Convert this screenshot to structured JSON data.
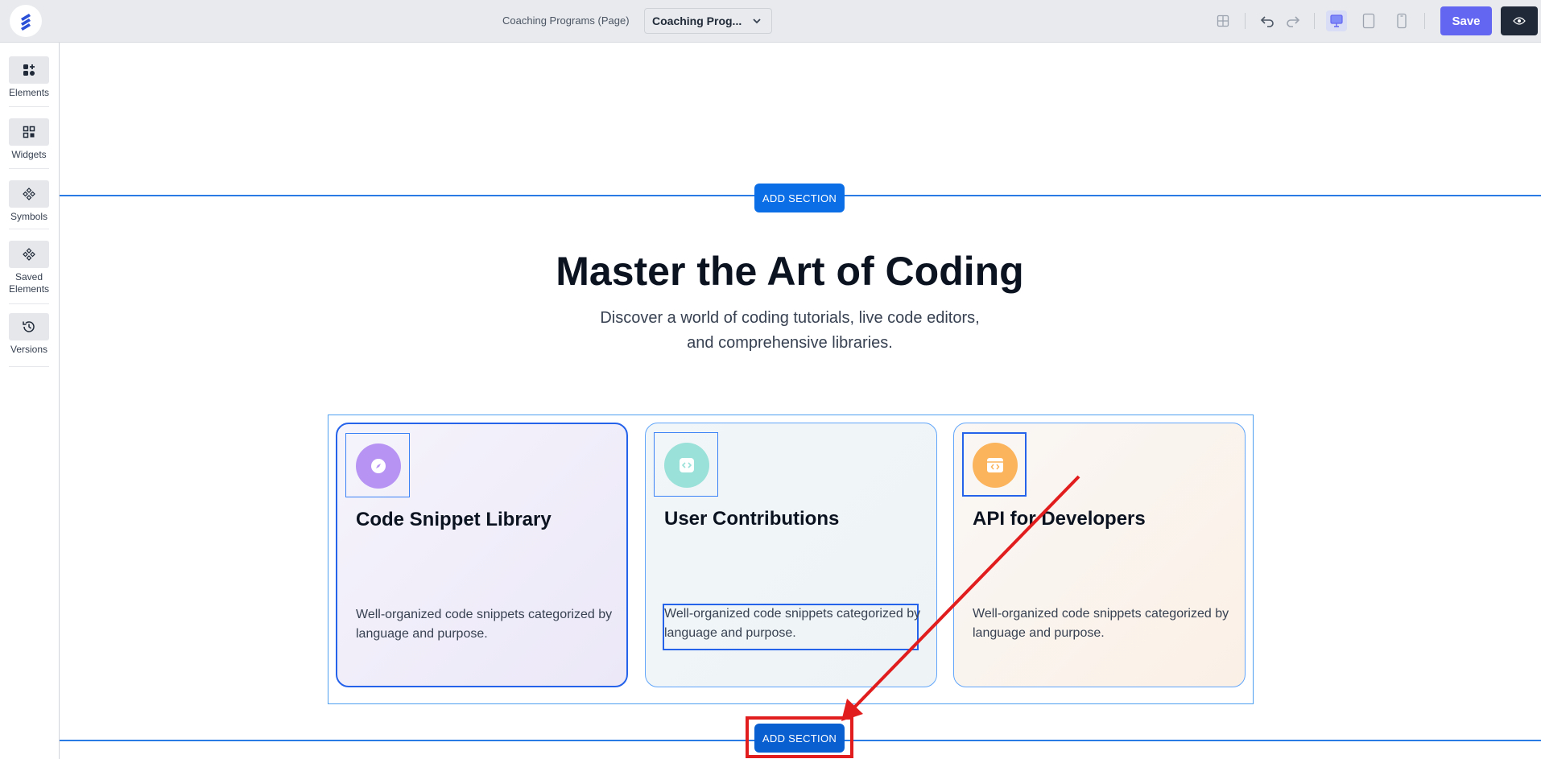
{
  "topbar": {
    "page_name": "Coaching Programs (Page)",
    "page_select_value": "Coaching Prog...",
    "save_label": "Save",
    "icons": [
      "logo-icon",
      "grid-icon",
      "undo-icon",
      "redo-icon",
      "desktop-icon",
      "tablet-icon",
      "mobile-icon",
      "eye-icon"
    ],
    "colors": {
      "save": "#6366f1",
      "preview": "#1f2937",
      "active_device": "#6366f1"
    }
  },
  "sidebar": {
    "items": [
      {
        "label": "Elements",
        "icon": "elements-icon"
      },
      {
        "label": "Widgets",
        "icon": "widgets-icon"
      },
      {
        "label": "Symbols",
        "icon": "symbols-icon"
      },
      {
        "label": "Saved Elements",
        "icon": "saved-elements-icon"
      },
      {
        "label": "Versions",
        "icon": "history-icon"
      }
    ]
  },
  "canvas": {
    "add_section_top": "ADD SECTION",
    "add_section_bottom": "ADD SECTION",
    "hero_title": "Master the Art of Coding",
    "hero_subtitle_line1": "Discover a world of coding tutorials, live code editors,",
    "hero_subtitle_line2": "and comprehensive libraries.",
    "cards": [
      {
        "title": "Code Snippet Library",
        "text": "Well-organized code snippets categorized by language and purpose.",
        "icon": "compass-icon",
        "icon_color": "#b794f4"
      },
      {
        "title": "User Contributions",
        "text": "Well-organized code snippets categorized by language and purpose.",
        "icon": "code-icon",
        "icon_color": "#99e1d9"
      },
      {
        "title": "API for Developers",
        "text": "Well-organized code snippets categorized by language and purpose.",
        "icon": "browser-code-icon",
        "icon_color": "#fbb45c"
      }
    ]
  },
  "annotation": {
    "color": "#e11d1d"
  }
}
